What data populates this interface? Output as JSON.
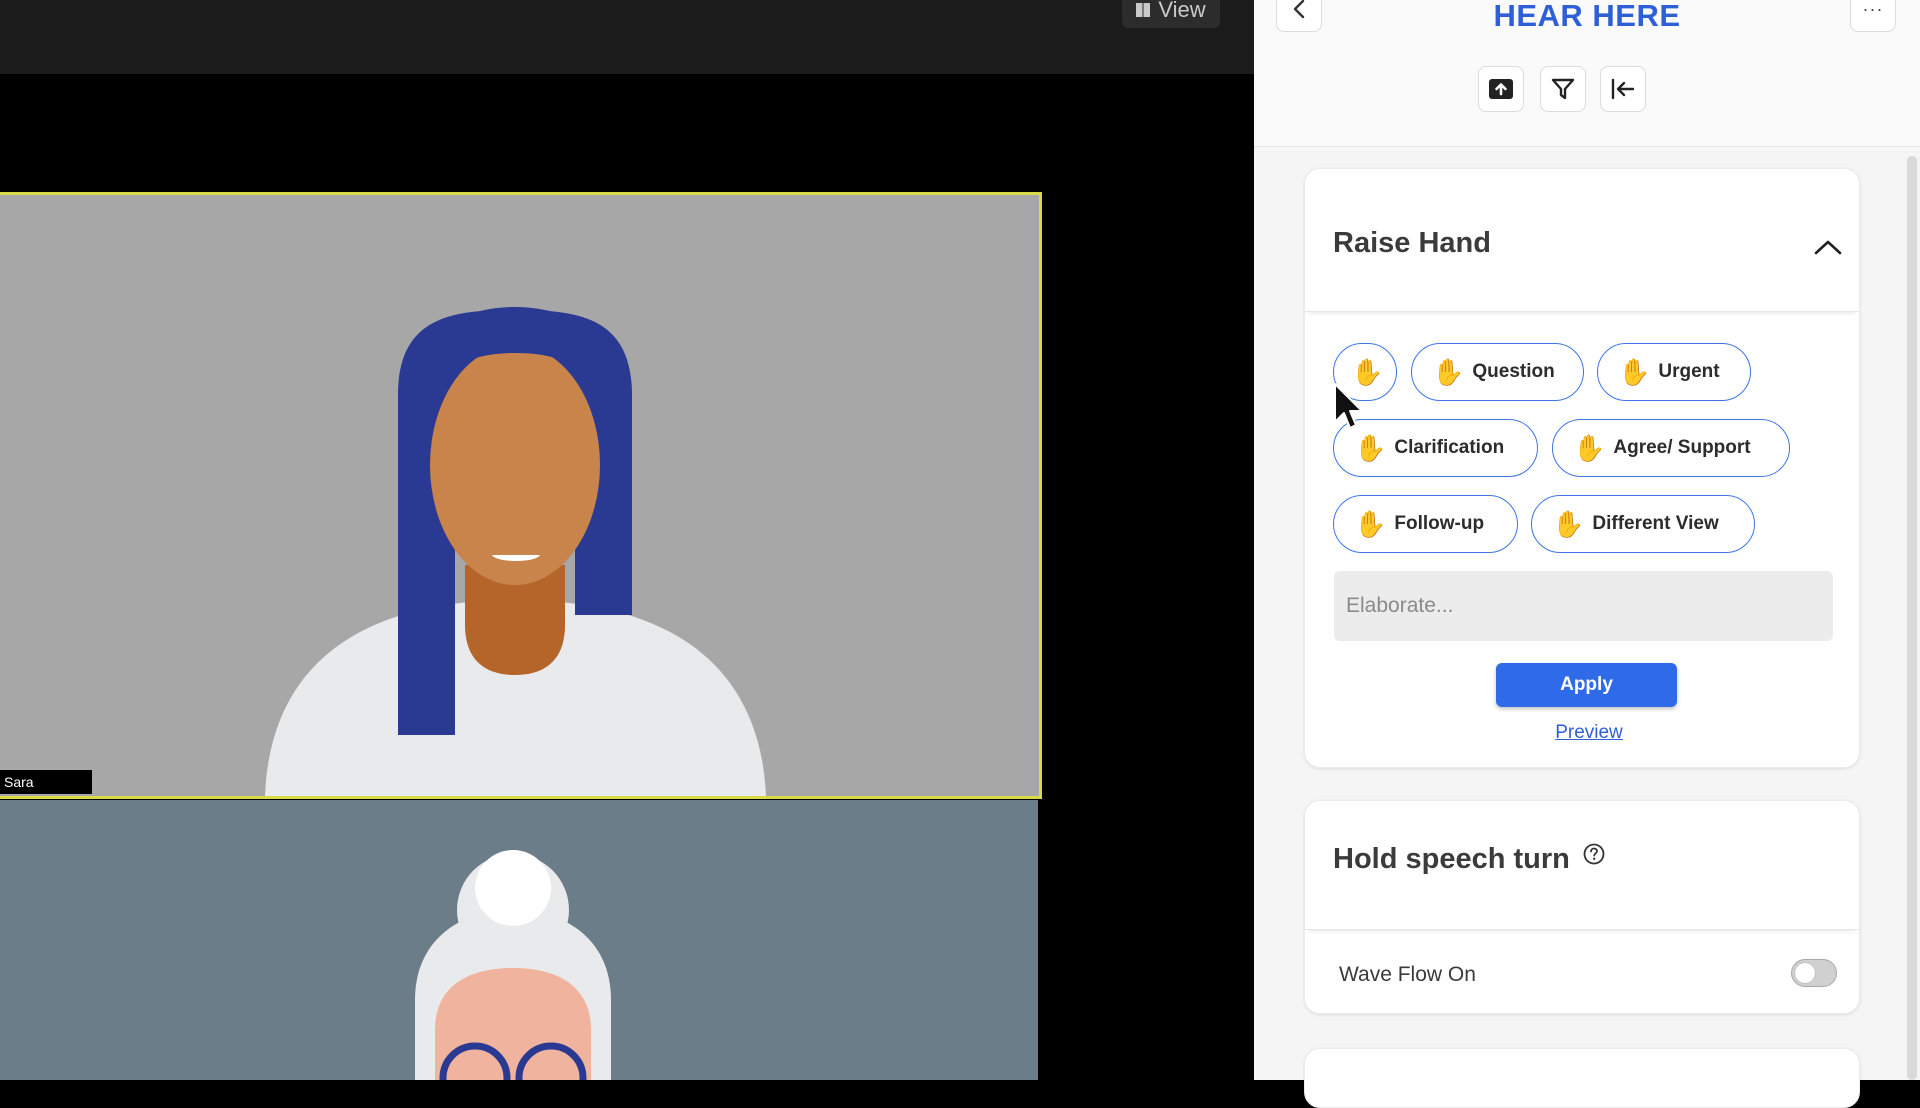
{
  "video": {
    "view_label": "View",
    "participants": [
      {
        "name": "Sara"
      }
    ]
  },
  "sidebar": {
    "title": "HEAR HERE",
    "more_label": "···",
    "raise_hand": {
      "title": "Raise Hand",
      "hand_icon": "✋",
      "options": [
        "Question",
        "Urgent",
        "Clarification",
        "Agree/ Support",
        "Follow-up",
        "Different View"
      ],
      "elaborate_placeholder": "Elaborate...",
      "apply_label": "Apply",
      "preview_label": "Preview"
    },
    "hold_speech": {
      "title": "Hold speech turn",
      "wave_label": "Wave Flow On",
      "wave_on": false
    }
  },
  "colors": {
    "accent": "#2f6ae8",
    "title_blue": "#2f5fd6",
    "active_speaker_border": "#d9d94a"
  }
}
